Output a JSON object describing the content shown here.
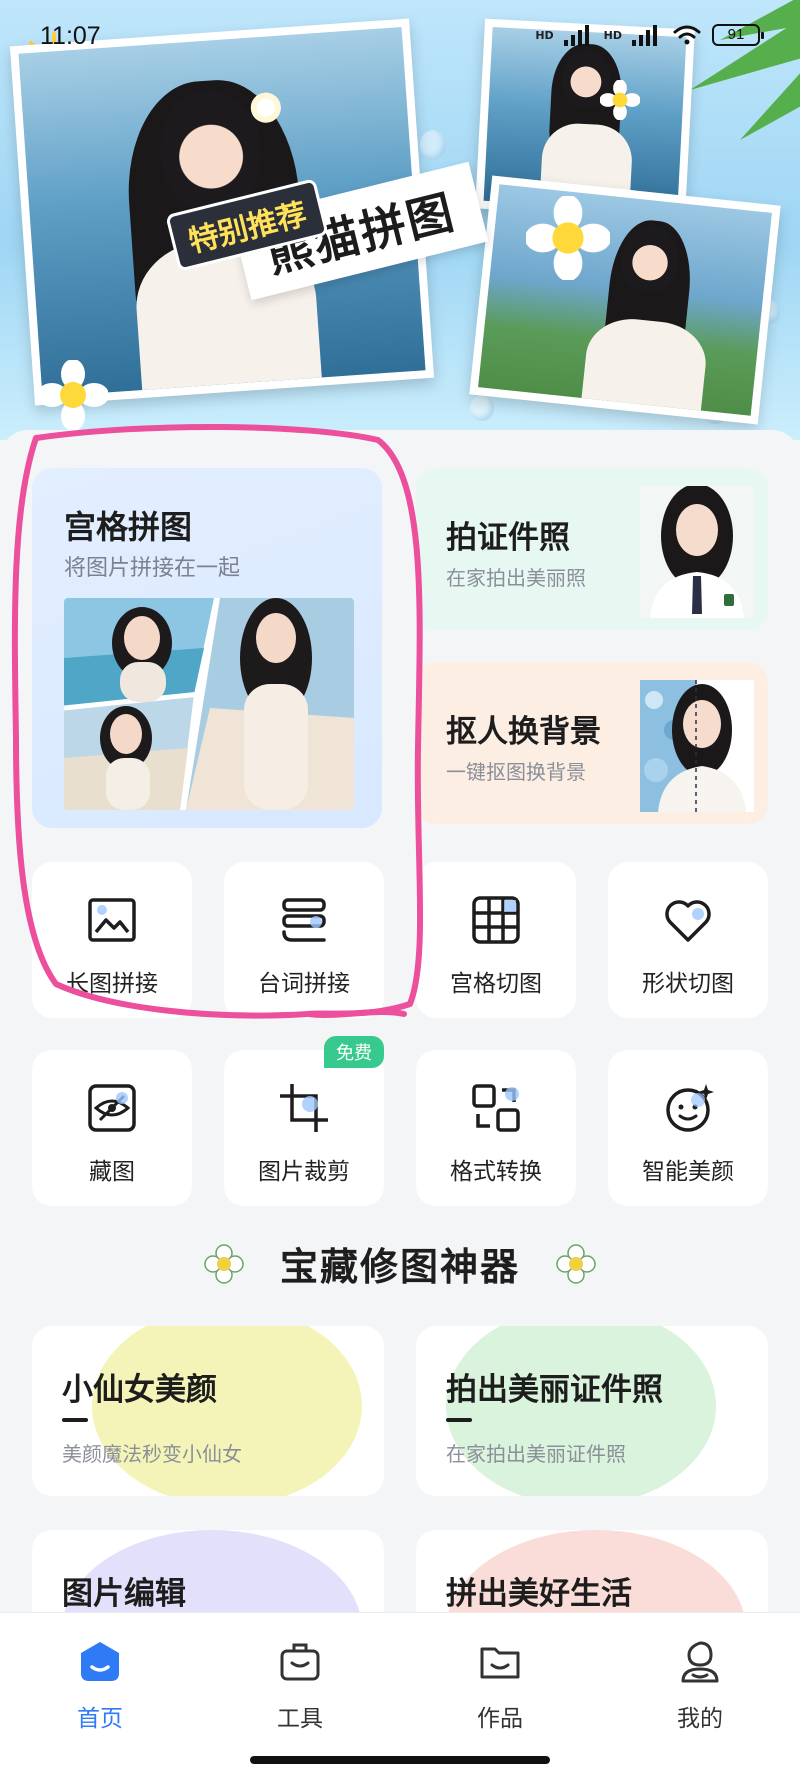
{
  "status_bar": {
    "time": "11:07",
    "network_1": "HD",
    "network_2": "HD",
    "battery": "91"
  },
  "banner": {
    "tag": "特别推荐",
    "title": "熊猫拼图"
  },
  "main_card": {
    "title": "宫格拼图",
    "subtitle": "将图片拼接在一起"
  },
  "side_cards": [
    {
      "title": "拍证件照",
      "subtitle": "在家拍出美丽照",
      "color": "#e7f8f3"
    },
    {
      "title": "抠人换背景",
      "subtitle": "一键抠图换背景",
      "color": "#fdeee4"
    }
  ],
  "tools_row1": [
    {
      "label": "长图拼接",
      "icon": "long-image-icon"
    },
    {
      "label": "台词拼接",
      "icon": "subtitle-stack-icon"
    },
    {
      "label": "宫格切图",
      "icon": "grid-cut-icon"
    },
    {
      "label": "形状切图",
      "icon": "heart-shape-icon"
    }
  ],
  "tools_row2": [
    {
      "label": "藏图",
      "icon": "hidden-eye-icon"
    },
    {
      "label": "图片裁剪",
      "icon": "crop-icon",
      "badge": "免费"
    },
    {
      "label": "格式转换",
      "icon": "format-convert-icon"
    },
    {
      "label": "智能美颜",
      "icon": "smart-beauty-icon"
    }
  ],
  "section": {
    "title": "宝藏修图神器"
  },
  "features": [
    {
      "title": "小仙女美颜",
      "subtitle": "美颜魔法秒变小仙女",
      "blob": "#f5f4b8"
    },
    {
      "title": "拍出美丽证件照",
      "subtitle": "在家拍出美丽证件照",
      "blob": "#d9f3dc"
    },
    {
      "title": "图片编辑",
      "subtitle": "",
      "blob": "#e2e0fb"
    },
    {
      "title": "拼出美好生活",
      "subtitle": "",
      "blob": "#fadcd8"
    }
  ],
  "tabs": [
    {
      "label": "首页",
      "icon": "home-icon",
      "active": true
    },
    {
      "label": "工具",
      "icon": "toolbox-icon",
      "active": false
    },
    {
      "label": "作品",
      "icon": "folder-icon",
      "active": false
    },
    {
      "label": "我的",
      "icon": "profile-icon",
      "active": false
    }
  ],
  "colors": {
    "accent": "#2f7bf6",
    "annotation": "#ec4f9c",
    "free_badge": "#37c98d"
  }
}
